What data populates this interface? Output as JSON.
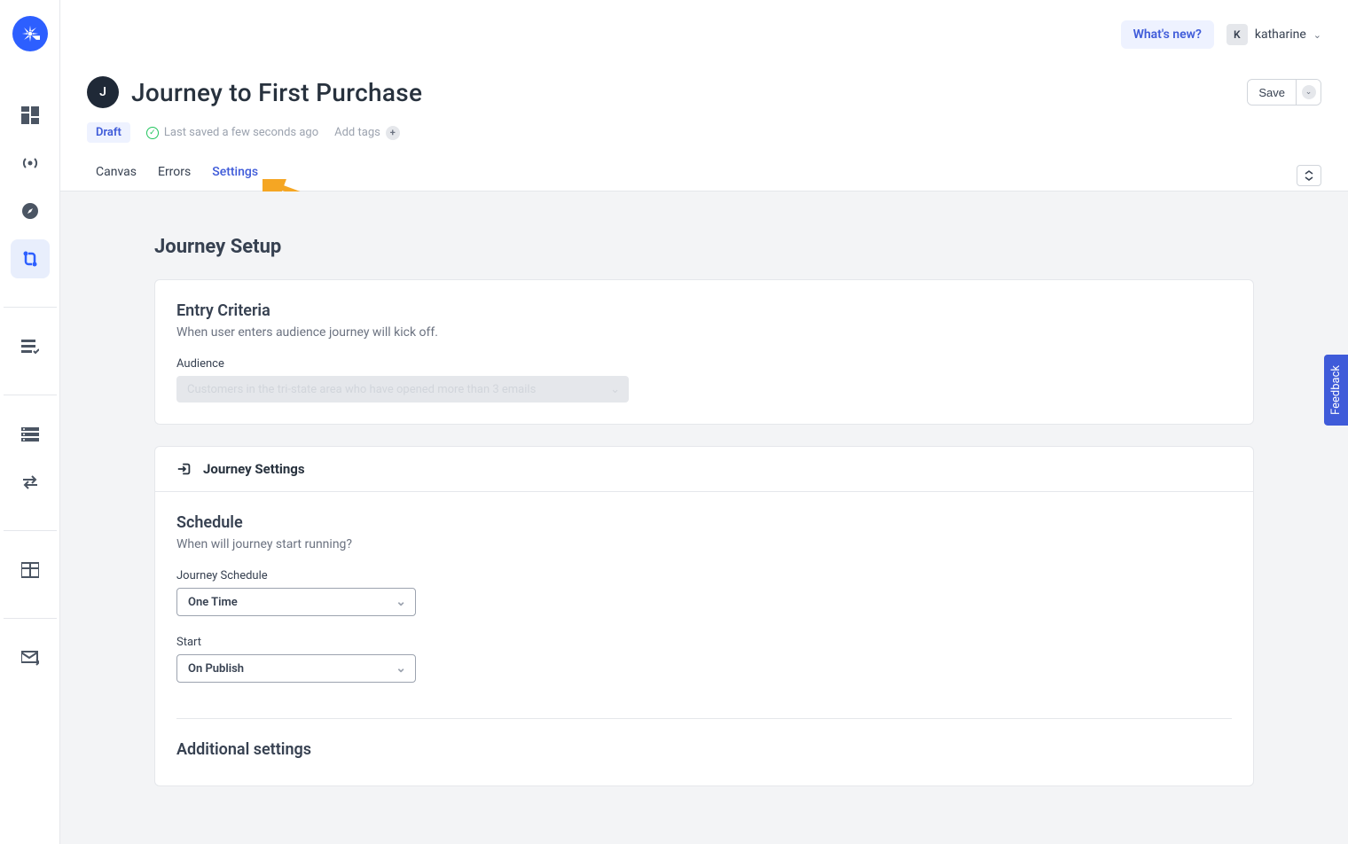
{
  "header": {
    "whats_new": "What's new?",
    "user_initial": "K",
    "user_name": "katharine"
  },
  "page": {
    "icon_letter": "J",
    "title": "Journey to First Purchase",
    "save_label": "Save",
    "status_badge": "Draft",
    "last_saved": "Last saved a few seconds ago",
    "add_tags": "Add tags"
  },
  "tabs": {
    "canvas": "Canvas",
    "errors": "Errors",
    "settings": "Settings"
  },
  "setup": {
    "heading": "Journey Setup",
    "entry": {
      "title": "Entry Criteria",
      "subtitle": "When user enters audience journey will kick off.",
      "audience_label": "Audience",
      "audience_value": "Customers in the tri-state area who have opened more than 3 emails"
    },
    "journey_settings_label": "Journey Settings",
    "schedule": {
      "title": "Schedule",
      "subtitle": "When will journey start running?",
      "schedule_label": "Journey Schedule",
      "schedule_value": "One Time",
      "start_label": "Start",
      "start_value": "On Publish"
    },
    "additional": "Additional settings"
  },
  "feedback_label": "Feedback"
}
